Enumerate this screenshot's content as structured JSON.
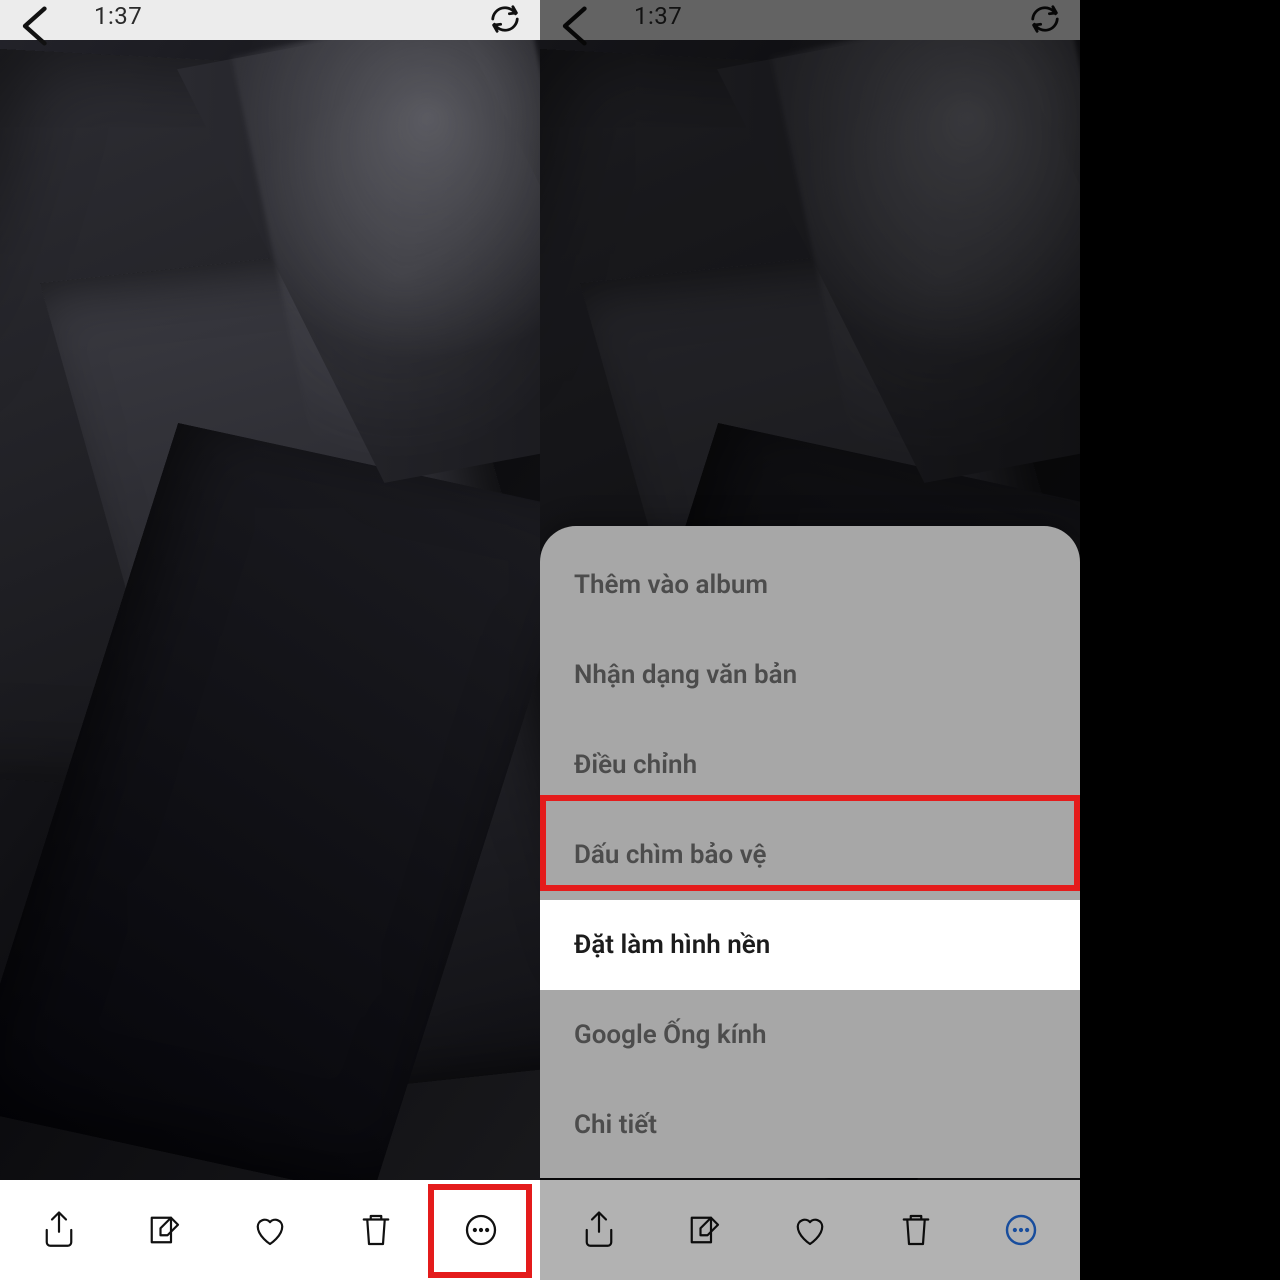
{
  "header": {
    "time": "1:37"
  },
  "menu": {
    "add_to_album": "Thêm vào album",
    "text_recognition": "Nhận dạng văn bản",
    "adjust": "Điều chỉnh",
    "watermark": "Dấu chìm bảo vệ",
    "set_wallpaper": "Đặt làm hình nền",
    "google_lens": "Google Ống kính",
    "details": "Chi tiết"
  },
  "colors": {
    "highlight": "#e41b1b",
    "accent": "#1f6fe6"
  }
}
